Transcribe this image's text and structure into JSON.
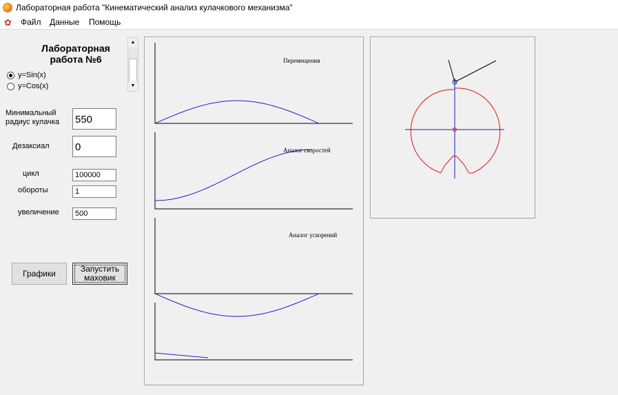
{
  "window": {
    "title": "Лабораторная работа \"Кинематический анализ кулачкового механизма\""
  },
  "menu": [
    "Файл",
    "Данные",
    "Помощь"
  ],
  "lab": {
    "title_line1": "Лабораторная",
    "title_line2": "работа №6"
  },
  "function_options": {
    "selected": "y=Sin(x)",
    "options": [
      "y=Sin(x)",
      "y=Cos(x)"
    ]
  },
  "params": {
    "min_radius_label_line1": "Минимальный",
    "min_radius_label_line2": "радиус кулачка",
    "min_radius_value": "550",
    "desaxial_label": "Дезаксиал",
    "desaxial_value": "0",
    "cycle_label": "цикл",
    "cycle_value": "100000",
    "revolutions_label": "обороты",
    "revolutions_value": "1",
    "zoom_label": "увеличение",
    "zoom_value": "500"
  },
  "buttons": {
    "graphs": "Графики",
    "start_line1": "Запустить",
    "start_line2": "маховик"
  },
  "graphs": {
    "displacement": "Перемещения",
    "velocity": "Аналог скоростей",
    "acceleration": "Аналог ускорений"
  },
  "colors": {
    "curve": "#1c1ccc",
    "cam": "#dd1111",
    "axes": "#000000",
    "cam_axes": "#1c1ccc"
  }
}
